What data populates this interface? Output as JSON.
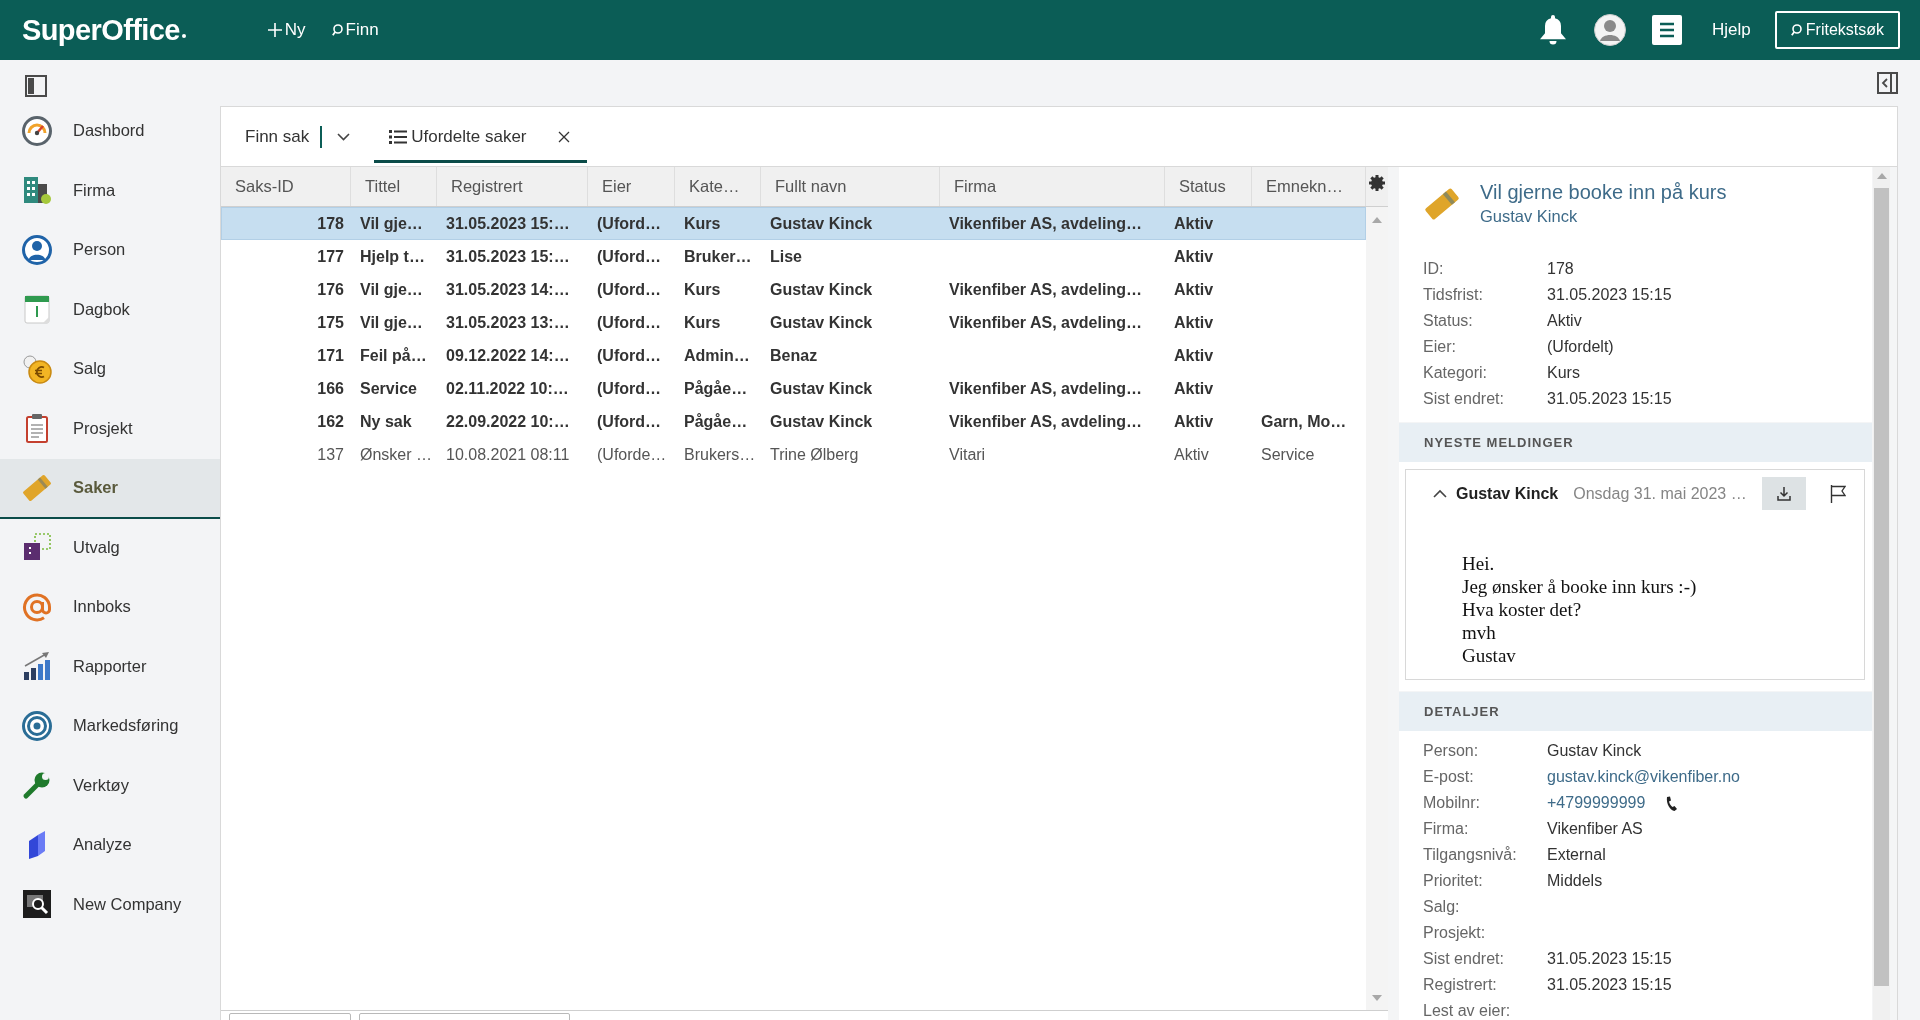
{
  "top_bar": {
    "logo": "SuperOffice",
    "new_button": "Ny",
    "find_button": "Finn",
    "help_link": "Hjelp",
    "search_button": "Fritekstsøk"
  },
  "sidebar": {
    "items": [
      {
        "label": "Dashbord",
        "selected": false
      },
      {
        "label": "Firma",
        "selected": false
      },
      {
        "label": "Person",
        "selected": false
      },
      {
        "label": "Dagbok",
        "selected": false
      },
      {
        "label": "Salg",
        "selected": false
      },
      {
        "label": "Prosjekt",
        "selected": false
      },
      {
        "label": "Saker",
        "selected": true
      },
      {
        "label": "Utvalg",
        "selected": false
      },
      {
        "label": "Innboks",
        "selected": false
      },
      {
        "label": "Rapporter",
        "selected": false
      },
      {
        "label": "Markedsføring",
        "selected": false
      },
      {
        "label": "Verktøy",
        "selected": false
      },
      {
        "label": "Analyze",
        "selected": false
      },
      {
        "label": "New Company",
        "selected": false
      }
    ]
  },
  "tabs": [
    {
      "kind": "search",
      "label": "Finn sak",
      "selected": false
    },
    {
      "kind": "list",
      "label": "Ufordelte saker",
      "selected": true
    }
  ],
  "table": {
    "columns": [
      "Saks-ID",
      "Tittel",
      "Registrert",
      "Eier",
      "Kate…",
      "Fullt navn",
      "Firma",
      "Status",
      "Emnekn…"
    ],
    "rows": [
      {
        "selected": true,
        "unread": true,
        "cells": [
          "178",
          "Vil gje…",
          "31.05.2023 15:…",
          "(Uford…",
          "Kurs",
          "Gustav Kinck",
          "Vikenfiber AS, avdeling…",
          "Aktiv",
          null
        ]
      },
      {
        "selected": false,
        "unread": true,
        "cells": [
          "177",
          "Hjelp t…",
          "31.05.2023 15:…",
          "(Uford…",
          "Bruker…",
          "Lise",
          null,
          "Aktiv",
          null
        ]
      },
      {
        "selected": false,
        "unread": true,
        "cells": [
          "176",
          "Vil gje…",
          "31.05.2023 14:…",
          "(Uford…",
          "Kurs",
          "Gustav Kinck",
          "Vikenfiber AS, avdeling…",
          "Aktiv",
          null
        ]
      },
      {
        "selected": false,
        "unread": true,
        "cells": [
          "175",
          "Vil gje…",
          "31.05.2023 13:…",
          "(Uford…",
          "Kurs",
          "Gustav Kinck",
          "Vikenfiber AS, avdeling…",
          "Aktiv",
          null
        ]
      },
      {
        "selected": false,
        "unread": true,
        "cells": [
          "171",
          "Feil på…",
          "09.12.2022 14:…",
          "(Uford…",
          "Admin…",
          "Benaz",
          null,
          "Aktiv",
          null
        ]
      },
      {
        "selected": false,
        "unread": true,
        "cells": [
          "166",
          "Service",
          "02.11.2022 10:…",
          "(Uford…",
          "Pågåe…",
          "Gustav Kinck",
          "Vikenfiber AS, avdeling…",
          "Aktiv",
          null
        ]
      },
      {
        "selected": false,
        "unread": true,
        "cells": [
          "162",
          "Ny sak",
          "22.09.2022 10:…",
          "(Uford…",
          "Pågåe…",
          "Gustav Kinck",
          "Vikenfiber AS, avdeling…",
          "Aktiv",
          "Garn, Mo…"
        ]
      },
      {
        "selected": false,
        "unread": false,
        "cells": [
          "137",
          "Ønsker …",
          "10.08.2021 08:11",
          "(Uforde…",
          "Brukers…",
          "Trine Ølberg",
          "Vitari",
          "Aktiv",
          "Service"
        ]
      }
    ]
  },
  "case_panel": {
    "title": "Vil gjerne booke inn på kurs",
    "subtitle": "Gustav Kinck",
    "fields": [
      {
        "label": "ID:",
        "value": "178"
      },
      {
        "label": "Tidsfrist:",
        "value": "31.05.2023 15:15"
      },
      {
        "label": "Status:",
        "value": "Aktiv"
      },
      {
        "label": "Eier:",
        "value": "(Ufordelt)"
      },
      {
        "label": "Kategori:",
        "value": "Kurs"
      },
      {
        "label": "Sist endret:",
        "value": "31.05.2023 15:15"
      }
    ],
    "messages_heading": "NYESTE MELDINGER",
    "message": {
      "author": "Gustav Kinck",
      "date": "Onsdag 31. mai 2023 …",
      "expanded": true,
      "body": "Hei.\nJeg ønsker å booke inn kurs :-)\nHva koster det?\nmvh\nGustav"
    },
    "details_heading": "DETALJER",
    "details": [
      {
        "kind": "text",
        "label": "Person:",
        "value": "Gustav Kinck"
      },
      {
        "kind": "link",
        "label": "E-post:",
        "value": "gustav.kinck@vikenfiber.no"
      },
      {
        "kind": "phone",
        "label": "Mobilnr:",
        "value": "+4799999999"
      },
      {
        "kind": "text",
        "label": "Firma:",
        "value": "Vikenfiber AS"
      },
      {
        "kind": "text",
        "label": "Tilgangsnivå:",
        "value": "External"
      },
      {
        "kind": "text",
        "label": "Prioritet:",
        "value": "Middels"
      },
      {
        "label": "Salg:"
      },
      {
        "label": "Prosjekt:"
      },
      {
        "kind": "text",
        "label": "Sist endret:",
        "value": "31.05.2023 15:15"
      },
      {
        "kind": "text",
        "label": "Registrert:",
        "value": "31.05.2023 15:15"
      },
      {
        "label": "Lest av eier:"
      }
    ]
  }
}
